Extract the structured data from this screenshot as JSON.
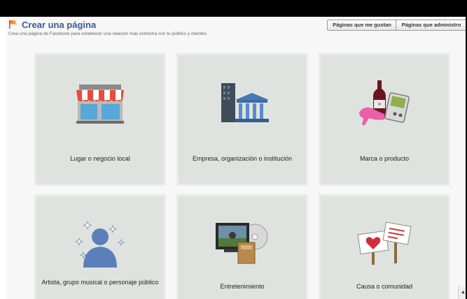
{
  "header": {
    "title": "Crear una página",
    "subtitle": "Crea una página de Facebook para establecer una relación más estrecha con tu público y clientes.",
    "liked_pages_label": "Páginas que me gustan",
    "admin_pages_label": "Páginas que administro"
  },
  "categories": [
    {
      "label": "Lugar o negocio local",
      "icon": "storefront-icon"
    },
    {
      "label": "Empresa, organización o institución",
      "icon": "company-building-icon"
    },
    {
      "label": "Marca o producto",
      "icon": "brand-products-icon"
    },
    {
      "label": "Artista, grupo musical o personaje público",
      "icon": "artist-silhouette-icon"
    },
    {
      "label": "Entretenimiento",
      "icon": "entertainment-tv-icon"
    },
    {
      "label": "Causa o comunidad",
      "icon": "community-signs-icon"
    }
  ],
  "colors": {
    "title": "#3b5998",
    "tile_background": "#dfe3df"
  }
}
